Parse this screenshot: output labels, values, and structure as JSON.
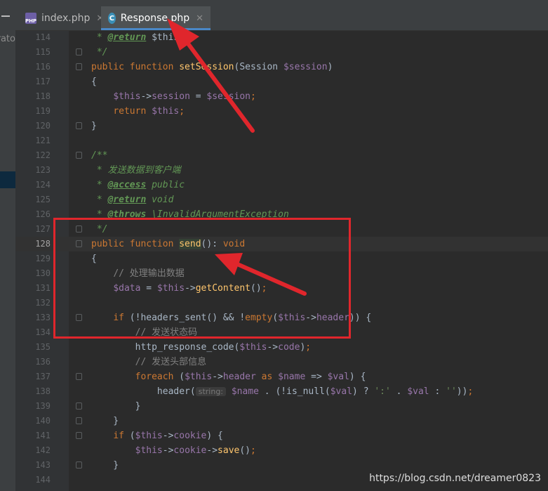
{
  "tabs": [
    {
      "label": "index.php",
      "icon": "php-file-icon",
      "active": false
    },
    {
      "label": "Response.php",
      "icon": "php-class-icon",
      "active": true
    }
  ],
  "side_panel_fragment": "rato",
  "icon_text": {
    "php": "PHP",
    "class": "C"
  },
  "close_glyph": "✕",
  "lines": [
    {
      "n": "114",
      "t": [
        [
          "doc",
          " * "
        ],
        [
          "tag",
          "@return"
        ],
        [
          "plain",
          " $this"
        ]
      ]
    },
    {
      "n": "115",
      "t": [
        [
          "doc",
          " */"
        ]
      ]
    },
    {
      "n": "116",
      "t": [
        [
          "kw",
          "public function "
        ],
        [
          "fn",
          "setSession"
        ],
        [
          "plain",
          "(Session "
        ],
        [
          "var",
          "$session"
        ],
        [
          "plain",
          ")"
        ]
      ]
    },
    {
      "n": "117",
      "t": [
        [
          "plain",
          "{"
        ]
      ]
    },
    {
      "n": "118",
      "t": [
        [
          "plain",
          "    "
        ],
        [
          "var",
          "$this"
        ],
        [
          "plain",
          "->"
        ],
        [
          "var",
          "session"
        ],
        [
          "plain",
          " = "
        ],
        [
          "var",
          "$session"
        ],
        [
          "kw",
          ";"
        ]
      ]
    },
    {
      "n": "119",
      "t": [
        [
          "plain",
          "    "
        ],
        [
          "kw",
          "return "
        ],
        [
          "var",
          "$this"
        ],
        [
          "kw",
          ";"
        ]
      ]
    },
    {
      "n": "120",
      "t": [
        [
          "plain",
          "}"
        ]
      ]
    },
    {
      "n": "121",
      "t": []
    },
    {
      "n": "122",
      "t": [
        [
          "doc",
          "/**"
        ]
      ]
    },
    {
      "n": "123",
      "t": [
        [
          "doc",
          " * 发送数据到客户端"
        ]
      ]
    },
    {
      "n": "124",
      "t": [
        [
          "doc",
          " * "
        ],
        [
          "tag",
          "@access"
        ],
        [
          "doc",
          " public"
        ]
      ]
    },
    {
      "n": "125",
      "t": [
        [
          "doc",
          " * "
        ],
        [
          "tag",
          "@return"
        ],
        [
          "doc",
          " void"
        ]
      ]
    },
    {
      "n": "126",
      "t": [
        [
          "doc",
          " * "
        ],
        [
          "tag",
          "@throws"
        ],
        [
          "doc",
          " \\InvalidArgumentException"
        ]
      ]
    },
    {
      "n": "127",
      "t": [
        [
          "doc",
          " */"
        ]
      ]
    },
    {
      "n": "128",
      "t": [
        [
          "kw",
          "public function "
        ],
        [
          "fn sendbox",
          "send"
        ],
        [
          "plain",
          "(): "
        ],
        [
          "kw",
          "void"
        ]
      ]
    },
    {
      "n": "129",
      "t": [
        [
          "plain",
          "{"
        ]
      ]
    },
    {
      "n": "130",
      "t": [
        [
          "plain",
          "    "
        ],
        [
          "cmt",
          "// 处理输出数据"
        ]
      ]
    },
    {
      "n": "131",
      "t": [
        [
          "plain",
          "    "
        ],
        [
          "var",
          "$data"
        ],
        [
          "plain",
          " = "
        ],
        [
          "var",
          "$this"
        ],
        [
          "plain",
          "->"
        ],
        [
          "fn",
          "getContent"
        ],
        [
          "plain",
          "()"
        ],
        [
          "kw",
          ";"
        ]
      ]
    },
    {
      "n": "132",
      "t": []
    },
    {
      "n": "133",
      "t": [
        [
          "plain",
          "    "
        ],
        [
          "kw",
          "if "
        ],
        [
          "plain",
          "(!"
        ],
        [
          "plain",
          "headers_sent() && !"
        ],
        [
          "kw",
          "empty"
        ],
        [
          "plain",
          "("
        ],
        [
          "var",
          "$this"
        ],
        [
          "plain",
          "->"
        ],
        [
          "var",
          "header"
        ],
        [
          "plain",
          ")) {"
        ]
      ]
    },
    {
      "n": "134",
      "t": [
        [
          "plain",
          "        "
        ],
        [
          "cmt",
          "// 发送状态码"
        ]
      ]
    },
    {
      "n": "135",
      "t": [
        [
          "plain",
          "        http_response_code("
        ],
        [
          "var",
          "$this"
        ],
        [
          "plain",
          "->"
        ],
        [
          "var",
          "code"
        ],
        [
          "plain",
          ")"
        ],
        [
          "kw",
          ";"
        ]
      ]
    },
    {
      "n": "136",
      "t": [
        [
          "plain",
          "        "
        ],
        [
          "cmt",
          "// 发送头部信息"
        ]
      ]
    },
    {
      "n": "137",
      "t": [
        [
          "plain",
          "        "
        ],
        [
          "kw",
          "foreach "
        ],
        [
          "plain",
          "("
        ],
        [
          "var",
          "$this"
        ],
        [
          "plain",
          "->"
        ],
        [
          "var",
          "header"
        ],
        [
          "kw",
          " as "
        ],
        [
          "var",
          "$name"
        ],
        [
          "plain",
          " => "
        ],
        [
          "var",
          "$val"
        ],
        [
          "plain",
          ") {"
        ]
      ]
    },
    {
      "n": "138",
      "t": [
        [
          "plain",
          "            header("
        ],
        [
          "hint",
          "string:"
        ],
        [
          "plain",
          " "
        ],
        [
          "var",
          "$name"
        ],
        [
          "plain",
          " . (!is_null("
        ],
        [
          "var",
          "$val"
        ],
        [
          "plain",
          ") ? "
        ],
        [
          "str",
          "':'"
        ],
        [
          "plain",
          " . "
        ],
        [
          "var",
          "$val"
        ],
        [
          "plain",
          " : "
        ],
        [
          "str",
          "''"
        ],
        [
          "plain",
          "))"
        ],
        [
          "kw",
          ";"
        ]
      ]
    },
    {
      "n": "139",
      "t": [
        [
          "plain",
          "        }"
        ]
      ]
    },
    {
      "n": "140",
      "t": [
        [
          "plain",
          "    }"
        ]
      ]
    },
    {
      "n": "141",
      "t": [
        [
          "plain",
          "    "
        ],
        [
          "kw",
          "if "
        ],
        [
          "plain",
          "("
        ],
        [
          "var",
          "$this"
        ],
        [
          "plain",
          "->"
        ],
        [
          "var",
          "cookie"
        ],
        [
          "plain",
          ") {"
        ]
      ]
    },
    {
      "n": "142",
      "t": [
        [
          "plain",
          "        "
        ],
        [
          "var",
          "$this"
        ],
        [
          "plain",
          "->"
        ],
        [
          "var",
          "cookie"
        ],
        [
          "plain",
          "->"
        ],
        [
          "fn",
          "save"
        ],
        [
          "plain",
          "()"
        ],
        [
          "kw",
          ";"
        ]
      ]
    },
    {
      "n": "143",
      "t": [
        [
          "plain",
          "    }"
        ]
      ]
    },
    {
      "n": "144",
      "t": []
    }
  ],
  "watermark": "https://blog.csdn.net/dreamer0823",
  "colors": {
    "annotation_red": "#e0262c",
    "background": "#2b2b2b"
  }
}
